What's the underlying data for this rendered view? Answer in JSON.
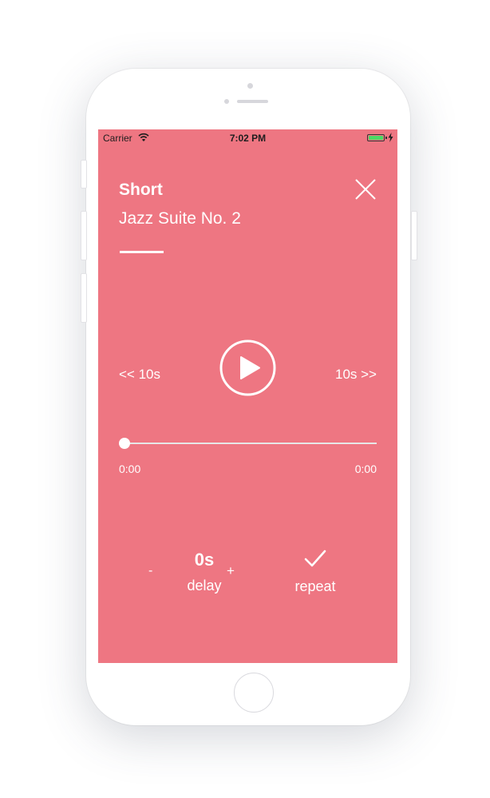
{
  "status_bar": {
    "carrier": "Carrier",
    "time": "7:02 PM"
  },
  "header": {
    "title": "Short",
    "subtitle": "Jazz Suite No. 2"
  },
  "controls": {
    "rewind_label": "<< 10s",
    "forward_label": "10s >>",
    "play_icon": "play-icon"
  },
  "progress": {
    "current_time": "0:00",
    "total_time": "0:00",
    "fraction": 0
  },
  "delay": {
    "minus_label": "-",
    "value": "0s",
    "label": "delay",
    "plus_label": "+"
  },
  "repeat": {
    "label": "repeat",
    "enabled": true
  },
  "colors": {
    "background": "#ee7682",
    "foreground": "#ffffff",
    "battery": "#4cd964"
  }
}
